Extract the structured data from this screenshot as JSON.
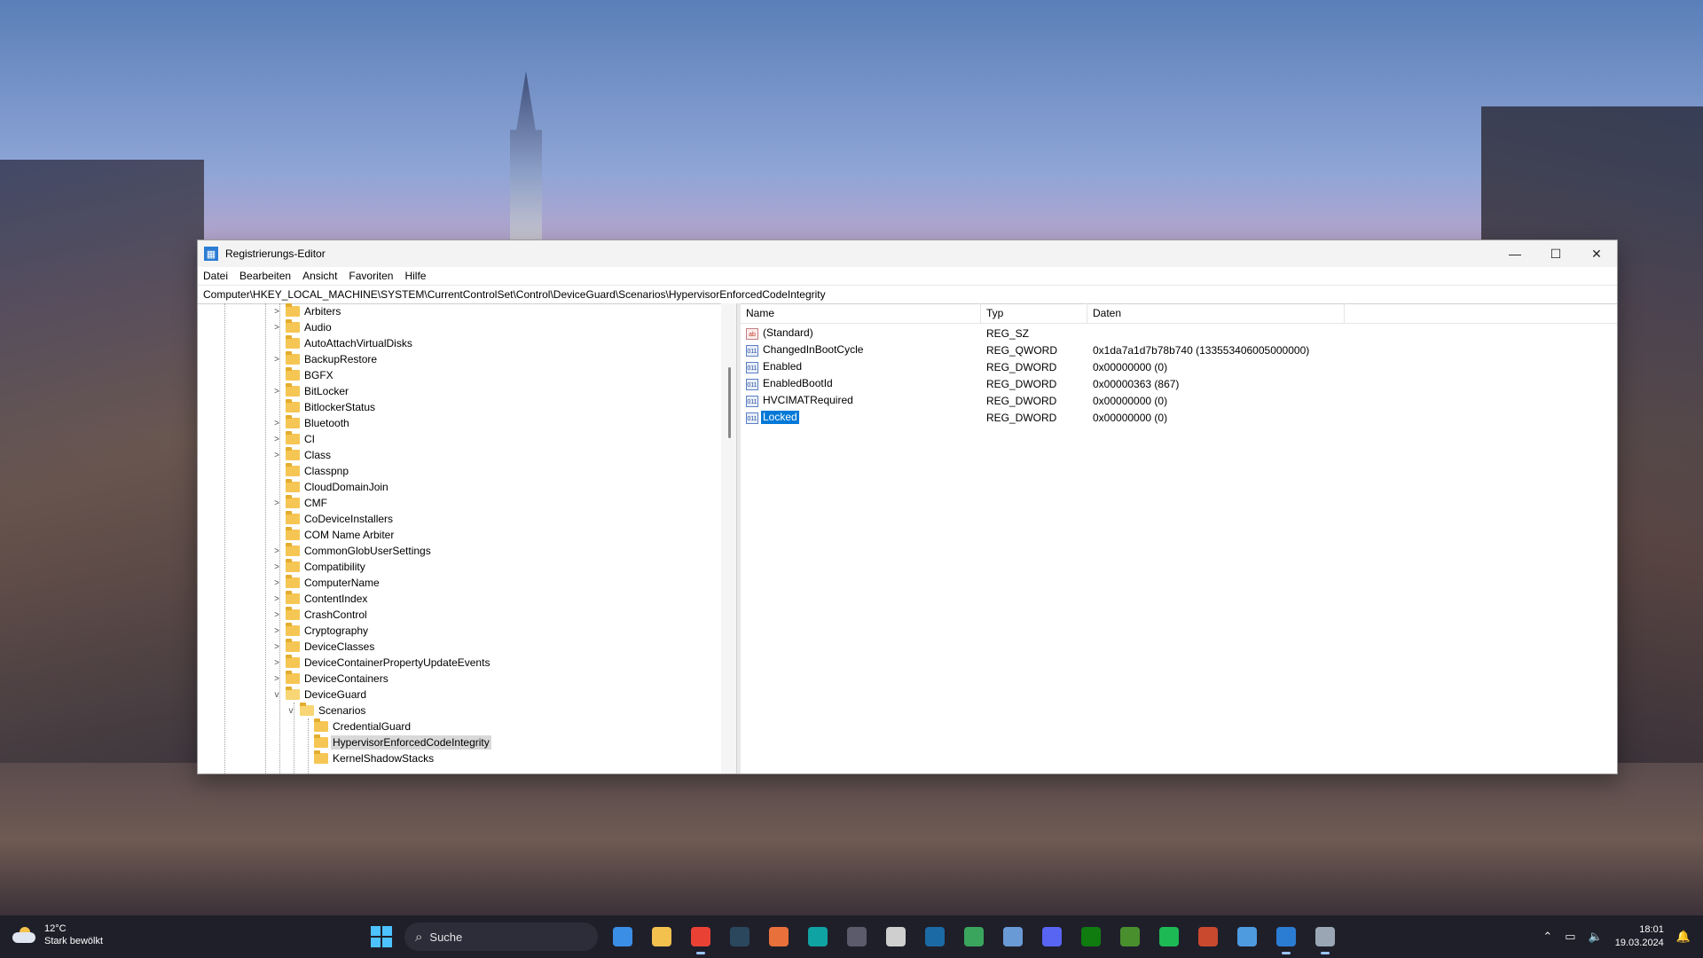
{
  "window": {
    "title": "Registrierungs-Editor",
    "controls": {
      "minimize": "—",
      "maximize": "☐",
      "close": "✕"
    }
  },
  "menu": [
    "Datei",
    "Bearbeiten",
    "Ansicht",
    "Favoriten",
    "Hilfe"
  ],
  "address": "Computer\\HKEY_LOCAL_MACHINE\\SYSTEM\\CurrentControlSet\\Control\\DeviceGuard\\Scenarios\\HypervisorEnforcedCodeIntegrity",
  "tree": [
    {
      "label": "Arbiters",
      "expander": ">"
    },
    {
      "label": "Audio",
      "expander": ">"
    },
    {
      "label": "AutoAttachVirtualDisks",
      "expander": ""
    },
    {
      "label": "BackupRestore",
      "expander": ">"
    },
    {
      "label": "BGFX",
      "expander": ""
    },
    {
      "label": "BitLocker",
      "expander": ">"
    },
    {
      "label": "BitlockerStatus",
      "expander": ""
    },
    {
      "label": "Bluetooth",
      "expander": ">"
    },
    {
      "label": "CI",
      "expander": ">"
    },
    {
      "label": "Class",
      "expander": ">"
    },
    {
      "label": "Classpnp",
      "expander": ""
    },
    {
      "label": "CloudDomainJoin",
      "expander": ""
    },
    {
      "label": "CMF",
      "expander": ">"
    },
    {
      "label": "CoDeviceInstallers",
      "expander": ""
    },
    {
      "label": "COM Name Arbiter",
      "expander": ""
    },
    {
      "label": "CommonGlobUserSettings",
      "expander": ">"
    },
    {
      "label": "Compatibility",
      "expander": ">"
    },
    {
      "label": "ComputerName",
      "expander": ">"
    },
    {
      "label": "ContentIndex",
      "expander": ">"
    },
    {
      "label": "CrashControl",
      "expander": ">"
    },
    {
      "label": "Cryptography",
      "expander": ">"
    },
    {
      "label": "DeviceClasses",
      "expander": ">"
    },
    {
      "label": "DeviceContainerPropertyUpdateEvents",
      "expander": ">"
    },
    {
      "label": "DeviceContainers",
      "expander": ">"
    },
    {
      "label": "DeviceGuard",
      "expander": "v"
    },
    {
      "label": "Scenarios",
      "expander": "v"
    },
    {
      "label": "CredentialGuard",
      "expander": ""
    },
    {
      "label": "HypervisorEnforcedCodeIntegrity",
      "expander": ""
    },
    {
      "label": "KernelShadowStacks",
      "expander": ""
    }
  ],
  "list": {
    "columns": [
      "Name",
      "Typ",
      "Daten"
    ],
    "rows": [
      {
        "icon": "ab",
        "name": "(Standard)",
        "type": "REG_SZ",
        "data": ""
      },
      {
        "icon": "011",
        "name": "ChangedInBootCycle",
        "type": "REG_QWORD",
        "data": "0x1da7a1d7b78b740 (133553406005000000)"
      },
      {
        "icon": "011",
        "name": "Enabled",
        "type": "REG_DWORD",
        "data": "0x00000000 (0)"
      },
      {
        "icon": "011",
        "name": "EnabledBootId",
        "type": "REG_DWORD",
        "data": "0x00000363 (867)"
      },
      {
        "icon": "011",
        "name": "HVCIMATRequired",
        "type": "REG_DWORD",
        "data": "0x00000000 (0)"
      },
      {
        "icon": "011",
        "name": "Locked",
        "type": "REG_DWORD",
        "data": "0x00000000 (0)"
      }
    ]
  },
  "taskbar": {
    "weather_temp": "12°C",
    "weather_desc": "Stark bewölkt",
    "search_placeholder": "Suche",
    "time": "18:01",
    "date": "19.03.2024",
    "apps": [
      {
        "name": "microsoft-store-icon",
        "color": "#3a8ee6"
      },
      {
        "name": "file-explorer-icon",
        "color": "#f2c14e"
      },
      {
        "name": "chrome-icon",
        "color": "#e94235"
      },
      {
        "name": "steam-icon",
        "color": "#2a475e"
      },
      {
        "name": "store-bag-icon",
        "color": "#e8703a"
      },
      {
        "name": "bf-app-icon",
        "color": "#0fa3a3"
      },
      {
        "name": "obs-icon",
        "color": "#5b5b6b"
      },
      {
        "name": "character-app-icon",
        "color": "#cfcfcf"
      },
      {
        "name": "steam-icon-2",
        "color": "#1b6aa5"
      },
      {
        "name": "green-app-icon",
        "color": "#3aa55d"
      },
      {
        "name": "equalizer-app-icon",
        "color": "#6a9ad6"
      },
      {
        "name": "discord-icon",
        "color": "#5865f2"
      },
      {
        "name": "xbox-icon",
        "color": "#107c10"
      },
      {
        "name": "minecraft-icon",
        "color": "#4a8f2e"
      },
      {
        "name": "spotify-icon",
        "color": "#1db954"
      },
      {
        "name": "toolbox-app-icon",
        "color": "#c9492f"
      },
      {
        "name": "task-manager-icon",
        "color": "#4e9be0"
      },
      {
        "name": "registry-editor-icon",
        "color": "#2b7cd3"
      },
      {
        "name": "settings-icon",
        "color": "#9aa6b3"
      }
    ]
  }
}
